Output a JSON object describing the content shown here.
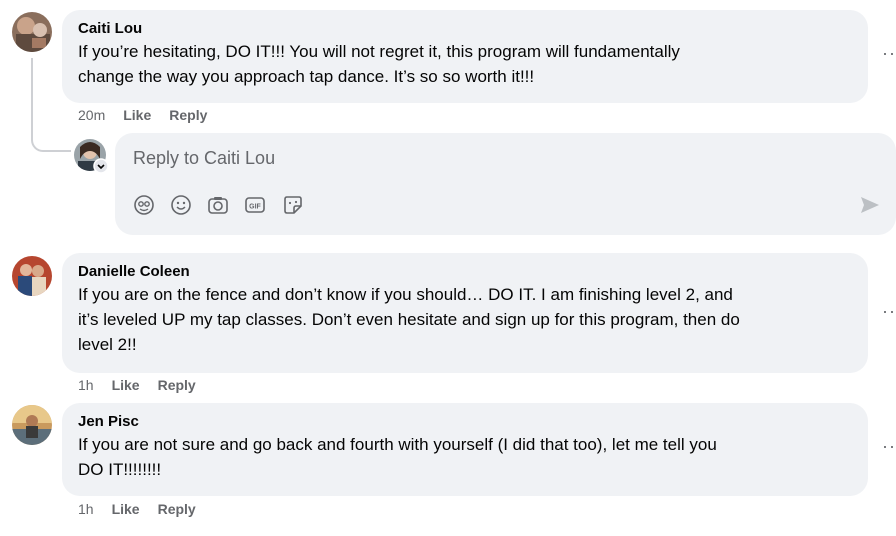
{
  "comments": [
    {
      "author": "Caiti Lou",
      "text_lines": [
        "If you’re hesitating, DO IT!!! You will not regret it, this program will fundamentally",
        "change the way you approach tap dance. It’s so so worth it!!!"
      ],
      "time": "20m",
      "like_label": "Like",
      "reply_label": "Reply"
    },
    {
      "author": "Danielle Coleen",
      "text_lines": [
        "If you are on the fence and don’t know if you should… DO IT. I am finishing level 2, and",
        "it’s leveled UP my tap classes. Don’t even hesitate and sign up for this program, then do",
        "level 2!!"
      ],
      "time": "1h",
      "like_label": "Like",
      "reply_label": "Reply"
    },
    {
      "author": "Jen Pisc",
      "text_lines": [
        "If you are not sure and go back and fourth with yourself (I did that too), let me tell you",
        "DO IT!!!!!!!!"
      ],
      "time": "1h",
      "like_label": "Like",
      "reply_label": "Reply"
    }
  ],
  "reply_box": {
    "placeholder": "Reply to Caiti Lou",
    "tools": [
      "avatar-sticker-icon",
      "emoji-icon",
      "camera-icon",
      "gif-icon",
      "sticker-icon"
    ],
    "gif_text": "GIF"
  },
  "menu_glyph": "··"
}
